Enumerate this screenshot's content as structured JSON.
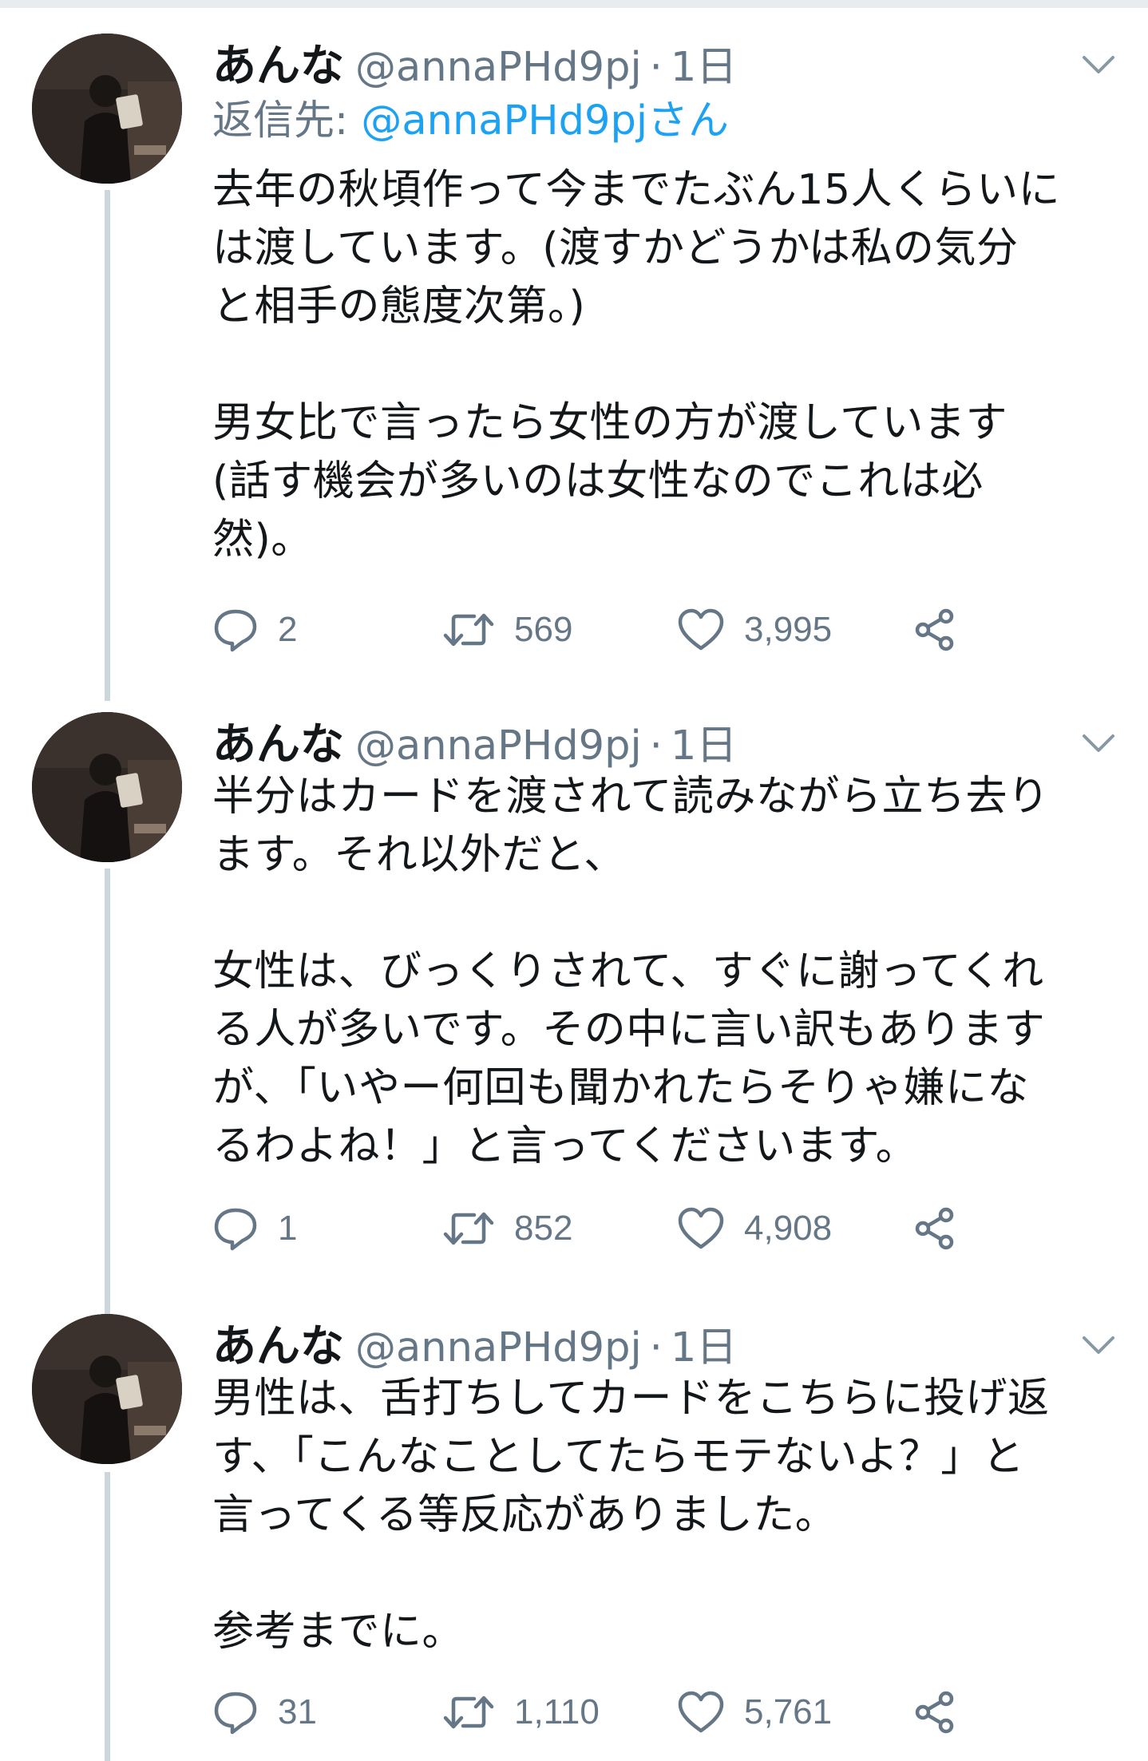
{
  "tweets": [
    {
      "name": "あんな",
      "handle": "@annaPHd9pj",
      "dot": "·",
      "time": "1日",
      "reply_prefix": "返信先: ",
      "reply_mention": "@annaPHd9pjさん",
      "text": "去年の秋頃作って今までたぶん15人くらいに\nは渡しています。(渡すかどうかは私の気分\nと相手の態度次第。)\n\n男女比で言ったら女性の方が渡しています\n(話す機会が多いのは女性なのでこれは必\n然)。",
      "replies": "2",
      "retweets": "569",
      "likes": "3,995"
    },
    {
      "name": "あんな",
      "handle": "@annaPHd9pj",
      "dot": "·",
      "time": "1日",
      "text": "半分はカードを渡されて読みながら立ち去り\nます。それ以外だと、\n\n女性は、びっくりされて、すぐに謝ってくれ\nる人が多いです。その中に言い訳もあります\nが、「いやー何回も聞かれたらそりゃ嫌にな\nるわよね！」と言ってくださいます。",
      "replies": "1",
      "retweets": "852",
      "likes": "4,908"
    },
    {
      "name": "あんな",
      "handle": "@annaPHd9pj",
      "dot": "·",
      "time": "1日",
      "text": "男性は、舌打ちしてカードをこちらに投げ返\nす、「こんなことしてたらモテないよ？」と\n言ってくる等反応がありました。\n\n参考までに。",
      "replies": "31",
      "retweets": "1,110",
      "likes": "5,761"
    }
  ],
  "icons": {
    "reply": "speech-bubble-icon",
    "retweet": "retweet-arrows-icon",
    "like": "heart-icon",
    "share": "share-nodes-icon",
    "menu": "chevron-down-icon"
  },
  "colors": {
    "text": "#14171a",
    "secondary": "#657786",
    "mention": "#1da1f2",
    "thread_line": "#ccd6dd",
    "divider": "#e6ecf0"
  }
}
